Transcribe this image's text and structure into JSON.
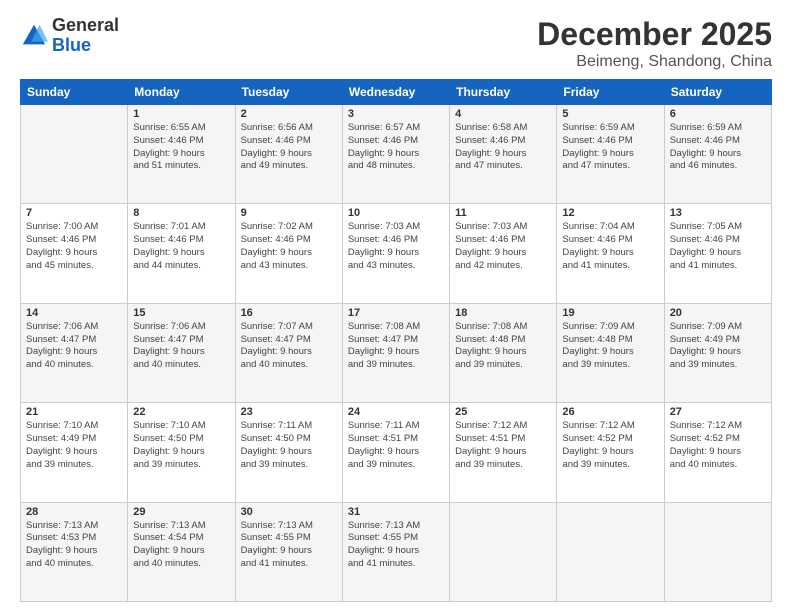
{
  "logo": {
    "general": "General",
    "blue": "Blue"
  },
  "header": {
    "month": "December 2025",
    "location": "Beimeng, Shandong, China"
  },
  "weekdays": [
    "Sunday",
    "Monday",
    "Tuesday",
    "Wednesday",
    "Thursday",
    "Friday",
    "Saturday"
  ],
  "weeks": [
    [
      {
        "day": "",
        "info": ""
      },
      {
        "day": "1",
        "info": "Sunrise: 6:55 AM\nSunset: 4:46 PM\nDaylight: 9 hours\nand 51 minutes."
      },
      {
        "day": "2",
        "info": "Sunrise: 6:56 AM\nSunset: 4:46 PM\nDaylight: 9 hours\nand 49 minutes."
      },
      {
        "day": "3",
        "info": "Sunrise: 6:57 AM\nSunset: 4:46 PM\nDaylight: 9 hours\nand 48 minutes."
      },
      {
        "day": "4",
        "info": "Sunrise: 6:58 AM\nSunset: 4:46 PM\nDaylight: 9 hours\nand 47 minutes."
      },
      {
        "day": "5",
        "info": "Sunrise: 6:59 AM\nSunset: 4:46 PM\nDaylight: 9 hours\nand 47 minutes."
      },
      {
        "day": "6",
        "info": "Sunrise: 6:59 AM\nSunset: 4:46 PM\nDaylight: 9 hours\nand 46 minutes."
      }
    ],
    [
      {
        "day": "7",
        "info": "Sunrise: 7:00 AM\nSunset: 4:46 PM\nDaylight: 9 hours\nand 45 minutes."
      },
      {
        "day": "8",
        "info": "Sunrise: 7:01 AM\nSunset: 4:46 PM\nDaylight: 9 hours\nand 44 minutes."
      },
      {
        "day": "9",
        "info": "Sunrise: 7:02 AM\nSunset: 4:46 PM\nDaylight: 9 hours\nand 43 minutes."
      },
      {
        "day": "10",
        "info": "Sunrise: 7:03 AM\nSunset: 4:46 PM\nDaylight: 9 hours\nand 43 minutes."
      },
      {
        "day": "11",
        "info": "Sunrise: 7:03 AM\nSunset: 4:46 PM\nDaylight: 9 hours\nand 42 minutes."
      },
      {
        "day": "12",
        "info": "Sunrise: 7:04 AM\nSunset: 4:46 PM\nDaylight: 9 hours\nand 41 minutes."
      },
      {
        "day": "13",
        "info": "Sunrise: 7:05 AM\nSunset: 4:46 PM\nDaylight: 9 hours\nand 41 minutes."
      }
    ],
    [
      {
        "day": "14",
        "info": "Sunrise: 7:06 AM\nSunset: 4:47 PM\nDaylight: 9 hours\nand 40 minutes."
      },
      {
        "day": "15",
        "info": "Sunrise: 7:06 AM\nSunset: 4:47 PM\nDaylight: 9 hours\nand 40 minutes."
      },
      {
        "day": "16",
        "info": "Sunrise: 7:07 AM\nSunset: 4:47 PM\nDaylight: 9 hours\nand 40 minutes."
      },
      {
        "day": "17",
        "info": "Sunrise: 7:08 AM\nSunset: 4:47 PM\nDaylight: 9 hours\nand 39 minutes."
      },
      {
        "day": "18",
        "info": "Sunrise: 7:08 AM\nSunset: 4:48 PM\nDaylight: 9 hours\nand 39 minutes."
      },
      {
        "day": "19",
        "info": "Sunrise: 7:09 AM\nSunset: 4:48 PM\nDaylight: 9 hours\nand 39 minutes."
      },
      {
        "day": "20",
        "info": "Sunrise: 7:09 AM\nSunset: 4:49 PM\nDaylight: 9 hours\nand 39 minutes."
      }
    ],
    [
      {
        "day": "21",
        "info": "Sunrise: 7:10 AM\nSunset: 4:49 PM\nDaylight: 9 hours\nand 39 minutes."
      },
      {
        "day": "22",
        "info": "Sunrise: 7:10 AM\nSunset: 4:50 PM\nDaylight: 9 hours\nand 39 minutes."
      },
      {
        "day": "23",
        "info": "Sunrise: 7:11 AM\nSunset: 4:50 PM\nDaylight: 9 hours\nand 39 minutes."
      },
      {
        "day": "24",
        "info": "Sunrise: 7:11 AM\nSunset: 4:51 PM\nDaylight: 9 hours\nand 39 minutes."
      },
      {
        "day": "25",
        "info": "Sunrise: 7:12 AM\nSunset: 4:51 PM\nDaylight: 9 hours\nand 39 minutes."
      },
      {
        "day": "26",
        "info": "Sunrise: 7:12 AM\nSunset: 4:52 PM\nDaylight: 9 hours\nand 39 minutes."
      },
      {
        "day": "27",
        "info": "Sunrise: 7:12 AM\nSunset: 4:52 PM\nDaylight: 9 hours\nand 40 minutes."
      }
    ],
    [
      {
        "day": "28",
        "info": "Sunrise: 7:13 AM\nSunset: 4:53 PM\nDaylight: 9 hours\nand 40 minutes."
      },
      {
        "day": "29",
        "info": "Sunrise: 7:13 AM\nSunset: 4:54 PM\nDaylight: 9 hours\nand 40 minutes."
      },
      {
        "day": "30",
        "info": "Sunrise: 7:13 AM\nSunset: 4:55 PM\nDaylight: 9 hours\nand 41 minutes."
      },
      {
        "day": "31",
        "info": "Sunrise: 7:13 AM\nSunset: 4:55 PM\nDaylight: 9 hours\nand 41 minutes."
      },
      {
        "day": "",
        "info": ""
      },
      {
        "day": "",
        "info": ""
      },
      {
        "day": "",
        "info": ""
      }
    ]
  ]
}
